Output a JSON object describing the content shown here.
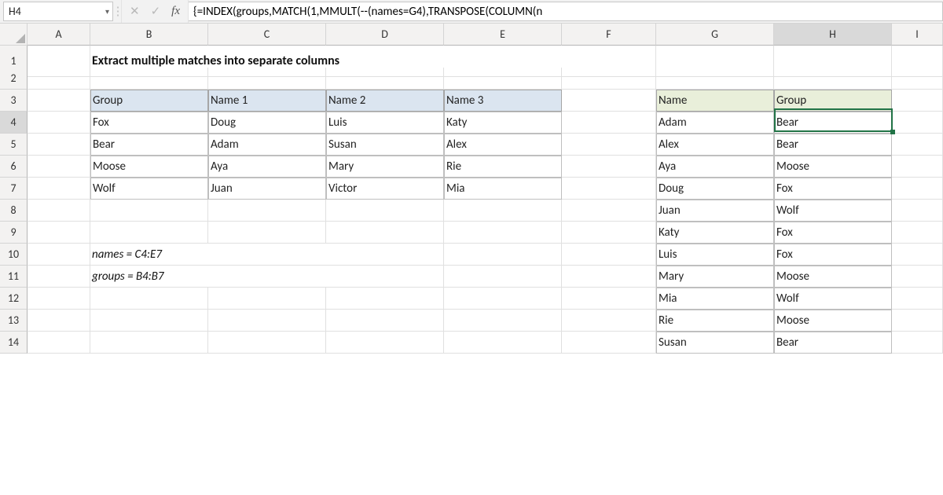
{
  "colors": {
    "excel_green": "#217346",
    "blue_hdr": "#dbe5f0",
    "green_hdr": "#e9efda"
  },
  "active": {
    "cell_ref": "H4",
    "row": 4,
    "col": "H"
  },
  "formula_bar": {
    "fx_label": "fx",
    "formula": "{=INDEX(groups,MATCH(1,MMULT(--(names=G4),TRANSPOSE(COLUMN(n"
  },
  "columns": [
    "A",
    "B",
    "C",
    "D",
    "E",
    "F",
    "G",
    "H",
    "I"
  ],
  "rows": [
    "1",
    "2",
    "3",
    "4",
    "5",
    "6",
    "7",
    "8",
    "9",
    "10",
    "11",
    "12",
    "13",
    "14"
  ],
  "title": "Extract multiple matches into separate columns",
  "notes": {
    "names_def": "names = C4:E7",
    "groups_def": "groups = B4:B7"
  },
  "main_table": {
    "headers": [
      "Group",
      "Name 1",
      "Name 2",
      "Name 3"
    ],
    "rows": [
      [
        "Fox",
        "Doug",
        "Luis",
        "Katy"
      ],
      [
        "Bear",
        "Adam",
        "Susan",
        "Alex"
      ],
      [
        "Moose",
        "Aya",
        "Mary",
        "Rie"
      ],
      [
        "Wolf",
        "Juan",
        "Victor",
        "Mia"
      ]
    ]
  },
  "lookup_table": {
    "headers": [
      "Name",
      "Group"
    ],
    "rows": [
      [
        "Adam",
        "Bear"
      ],
      [
        "Alex",
        "Bear"
      ],
      [
        "Aya",
        "Moose"
      ],
      [
        "Doug",
        "Fox"
      ],
      [
        "Juan",
        "Wolf"
      ],
      [
        "Katy",
        "Fox"
      ],
      [
        "Luis",
        "Fox"
      ],
      [
        "Mary",
        "Moose"
      ],
      [
        "Mia",
        "Wolf"
      ],
      [
        "Rie",
        "Moose"
      ],
      [
        "Susan",
        "Bear"
      ]
    ]
  },
  "icons": {
    "dropdown": "▾",
    "cancel": "✕",
    "enter": "✓",
    "grip": "⋮"
  }
}
